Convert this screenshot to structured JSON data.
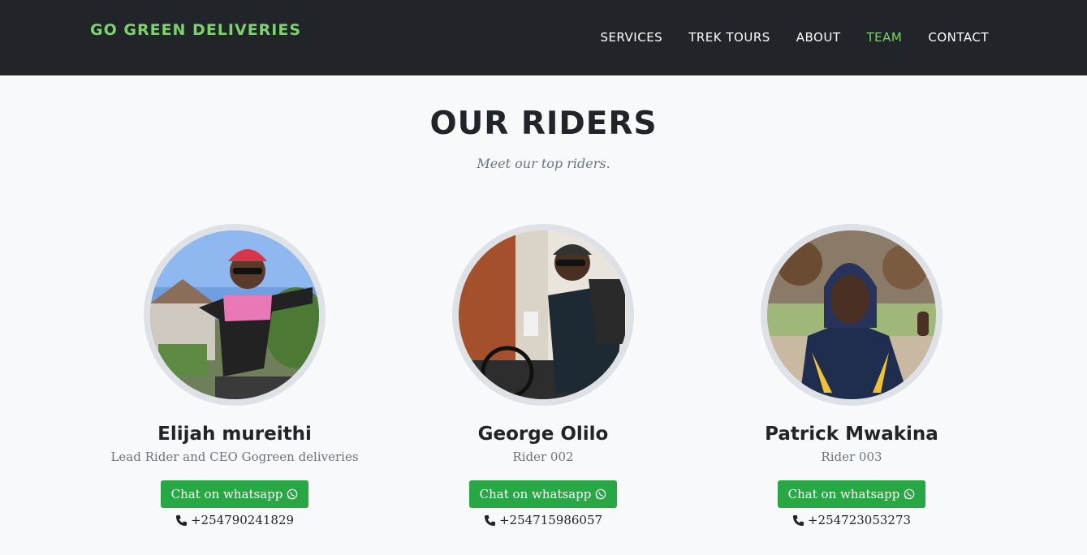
{
  "brand": "GO GREEN DELIVERIES",
  "nav": [
    {
      "label": "SERVICES",
      "active": false
    },
    {
      "label": "TREK TOURS",
      "active": false
    },
    {
      "label": "ABOUT",
      "active": false
    },
    {
      "label": "TEAM",
      "active": true
    },
    {
      "label": "CONTACT",
      "active": false
    }
  ],
  "section": {
    "title": "OUR RIDERS",
    "subtitle": "Meet our top riders."
  },
  "riders": [
    {
      "name": "Elijah mureithi",
      "role": "Lead Rider and CEO Gogreen deliveries",
      "button": "Chat on whatsapp",
      "phone": "+254790241829"
    },
    {
      "name": "George Olilo",
      "role": "Rider 002",
      "button": "Chat on whatsapp",
      "phone": "+254715986057"
    },
    {
      "name": "Patrick Mwakina",
      "role": "Rider 003",
      "button": "Chat on whatsapp",
      "phone": "+254723053273"
    }
  ],
  "colors": {
    "accent": "#7cd36b",
    "navbar": "#212529",
    "button": "#28a745"
  },
  "icons": {
    "whatsapp": "whatsapp-icon",
    "phone": "phone-icon"
  }
}
